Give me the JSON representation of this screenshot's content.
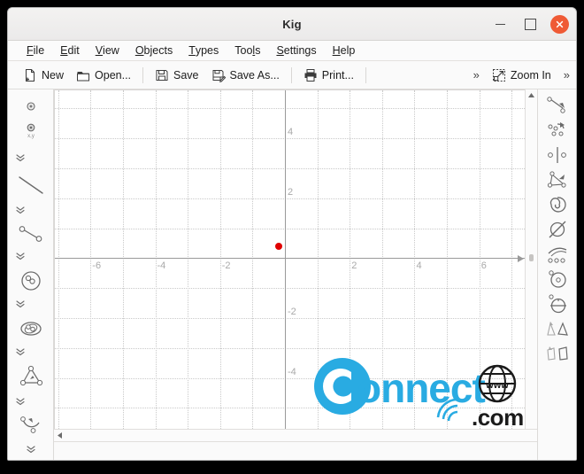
{
  "window": {
    "title": "Kig",
    "minimize_label": "minimize",
    "maximize_label": "maximize",
    "close_label": "close"
  },
  "menubar": {
    "items": [
      {
        "label": "File",
        "mnemonic": "F"
      },
      {
        "label": "Edit",
        "mnemonic": "E"
      },
      {
        "label": "View",
        "mnemonic": "V"
      },
      {
        "label": "Objects",
        "mnemonic": "O"
      },
      {
        "label": "Types",
        "mnemonic": "T"
      },
      {
        "label": "Tools",
        "mnemonic": "l"
      },
      {
        "label": "Settings",
        "mnemonic": "S"
      },
      {
        "label": "Help",
        "mnemonic": "H"
      }
    ]
  },
  "toolbar": {
    "new_label": "New",
    "open_label": "Open...",
    "save_label": "Save",
    "save_as_label": "Save As...",
    "print_label": "Print...",
    "overflow_label": "»",
    "zoom_in_label": "Zoom In",
    "overflow_right_label": "»"
  },
  "left_toolbar": {
    "items": [
      {
        "name": "point-tool",
        "expander": false
      },
      {
        "name": "point-by-coordinates-tool",
        "label": "x,y",
        "expander": false
      },
      {
        "name": "expand-points-group",
        "expander": true
      },
      {
        "name": "line-tool",
        "expander": false
      },
      {
        "name": "expand-lines-group",
        "expander": true
      },
      {
        "name": "segment-tool",
        "expander": false
      },
      {
        "name": "expand-segments-group",
        "expander": true
      },
      {
        "name": "circle-tool",
        "expander": false
      },
      {
        "name": "expand-circles-group",
        "expander": true
      },
      {
        "name": "conic-tool",
        "expander": false
      },
      {
        "name": "expand-conics-group",
        "expander": true
      },
      {
        "name": "polygon-tool",
        "expander": false
      },
      {
        "name": "expand-polygons-group",
        "expander": true
      },
      {
        "name": "arc-tool",
        "expander": false
      },
      {
        "name": "expand-more-group",
        "expander": true
      }
    ]
  },
  "right_toolbar": {
    "items": [
      {
        "name": "translate-tool"
      },
      {
        "name": "rotate-tool"
      },
      {
        "name": "reflect-over-line-tool"
      },
      {
        "name": "similitude-tool"
      },
      {
        "name": "spiral-tool"
      },
      {
        "name": "invert-tool"
      },
      {
        "name": "locus-tool"
      },
      {
        "name": "circle-through-points-tool"
      },
      {
        "name": "ellipse-tool"
      },
      {
        "name": "triangle-transform-tool"
      },
      {
        "name": "polygon-transform-tool"
      }
    ]
  },
  "canvas": {
    "point_color": "#e00000",
    "axis_color": "#9a9a9a",
    "grid_color": "#c9c9c9",
    "tick_label_color": "#a9a9a9"
  },
  "chart_data": {
    "type": "scatter",
    "title": "",
    "xlabel": "",
    "ylabel": "",
    "xlim": [
      -7.1,
      7.4
    ],
    "ylim": [
      -5.7,
      5.6
    ],
    "grid": true,
    "grid_step": 1,
    "xtick_labels": [
      "-6",
      "-4",
      "-2",
      "2",
      "4",
      "6"
    ],
    "xtick_values": [
      -6,
      -4,
      -2,
      2,
      4,
      6
    ],
    "ytick_labels": [
      "4",
      "2",
      "-2",
      "-4"
    ],
    "ytick_values": [
      4,
      2,
      -2,
      -4
    ],
    "legend": "none",
    "series": [
      {
        "name": "point",
        "color": "#e00000",
        "points": [
          {
            "x": -0.2,
            "y": 0.4
          }
        ]
      }
    ]
  },
  "watermark": {
    "text_main": "onnect",
    "text_c": "C",
    "text_dot_com": ".com",
    "text_www": "www",
    "color": "#29abe2",
    "dark": "#1b1b1b"
  },
  "scrollbars": {
    "vertical_up_label": "▲",
    "horizontal_left_label": "◀"
  },
  "statusbar": {
    "text": ""
  }
}
